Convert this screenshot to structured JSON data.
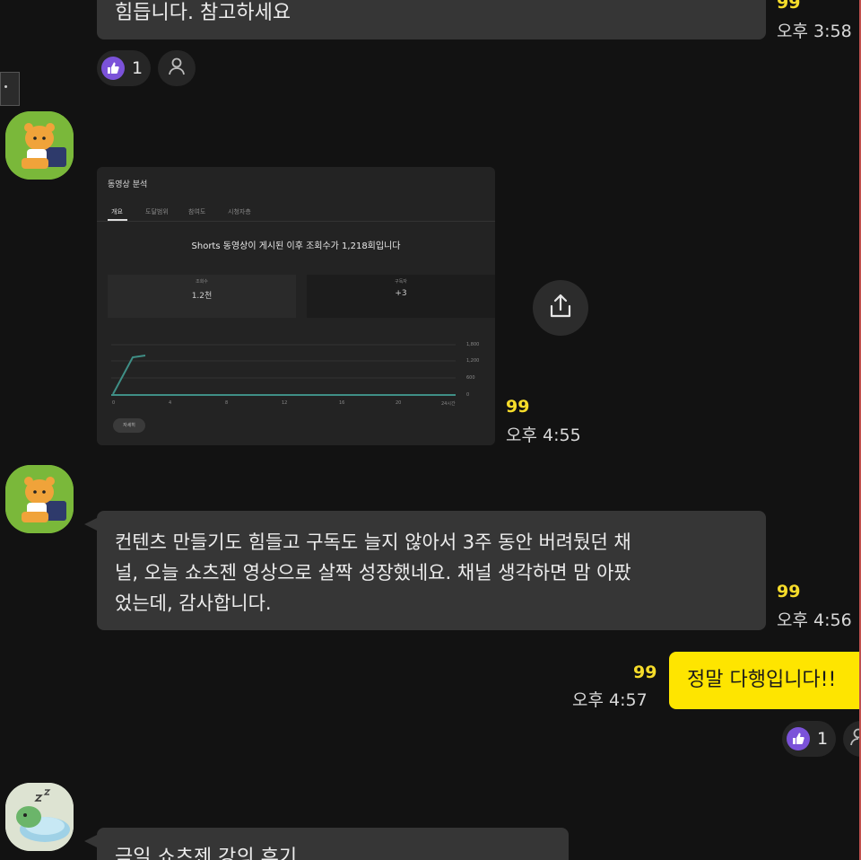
{
  "colors": {
    "background": "#121212",
    "bubble": "#363636",
    "my_bubble": "#fee500",
    "unread": "#f6dc2a",
    "reaction_like": "#7b52d9"
  },
  "messages": {
    "msg1": {
      "text": "힘듭니다. 참고하세요",
      "unread": "99",
      "time": "오후 3:58",
      "reaction_count": "1"
    },
    "msg2": {
      "unread": "99",
      "time": "오후 4:55",
      "share_icon": "share-icon",
      "screenshot": {
        "title": "동영상 분석",
        "tabs": [
          "개요",
          "도달범위",
          "참여도",
          "시청자층"
        ],
        "headline": "Shorts 동영상이 게시된 이후 조회수가 1,218회입니다",
        "stat1_label": "조회수",
        "stat1_value": "1.2천",
        "stat2_label": "구독자",
        "stat2_value": "+3",
        "y_ticks": [
          "1,800",
          "1,200",
          "600",
          "0"
        ],
        "x_ticks": [
          "0",
          "4",
          "8",
          "12",
          "16",
          "20",
          "24시간"
        ],
        "button": "자세히"
      }
    },
    "msg3": {
      "lines": [
        "컨텐츠 만들기도 힘들고 구독도 늘지 않아서 3주 동안 버려뒀던 채",
        "널, 오늘 쇼츠젠 영상으로 살짝 성장했네요. 채널 생각하면 맘 아팠",
        "었는데, 감사합니다."
      ],
      "unread": "99",
      "time": "오후 4:56"
    },
    "msg4": {
      "text": "정말 다행입니다!!",
      "unread": "99",
      "time": "오후 4:57",
      "reaction_count": "1"
    },
    "msg5": {
      "text": "금일 쇼츠젠 강의 후기"
    }
  }
}
